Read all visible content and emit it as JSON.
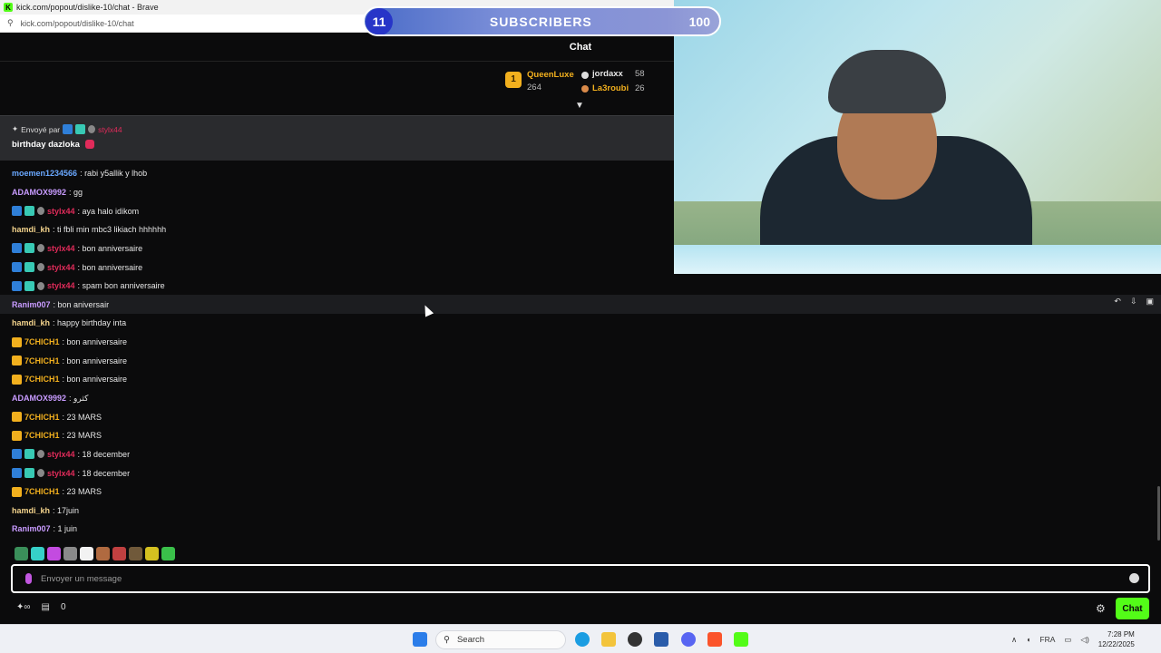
{
  "browser": {
    "title": "kick.com/popout/dislike-10/chat - Brave",
    "url": "kick.com/popout/dislike-10/chat"
  },
  "subgoal": {
    "current": "11",
    "label": "SUBSCRIBERS",
    "goal": "100"
  },
  "chat_title": "Chat",
  "leaderboard": {
    "first": {
      "name": "QueenLuxe",
      "count": "264"
    },
    "second": {
      "name": "jordaxx",
      "count": "58"
    },
    "third": {
      "name": "La3roubi",
      "count": "26"
    }
  },
  "pinned": {
    "sent_by_label": "Envoyé par",
    "sender": "stylx44",
    "message": "birthday dazloka"
  },
  "messages": [
    {
      "user": "moemen1234566",
      "color": "#6aa8ff",
      "badges": [],
      "text": ": rabi y5allik y lhob"
    },
    {
      "user": "ADAMOX9992",
      "color": "#c89bff",
      "badges": [],
      "text": ": gg"
    },
    {
      "user": "stylx44",
      "color": "#e02b5a",
      "badges": [
        "blue",
        "teal",
        "shield"
      ],
      "text": ": aya halo idikom"
    },
    {
      "user": "hamdi_kh",
      "color": "#f3d38c",
      "badges": [],
      "text": ": ti fbli min mbc3 likiach hhhhhh"
    },
    {
      "user": "stylx44",
      "color": "#e02b5a",
      "badges": [
        "blue",
        "teal",
        "shield"
      ],
      "text": ": bon anniversaire"
    },
    {
      "user": "stylx44",
      "color": "#e02b5a",
      "badges": [
        "blue",
        "teal",
        "shield"
      ],
      "text": ": bon anniversaire"
    },
    {
      "user": "stylx44",
      "color": "#e02b5a",
      "badges": [
        "blue",
        "teal",
        "shield"
      ],
      "text": ": spam bon anniversaire"
    },
    {
      "user": "Ranim007",
      "color": "#c89bff",
      "badges": [],
      "text": ": bon aniversair",
      "highlight": true
    },
    {
      "user": "hamdi_kh",
      "color": "#f3d38c",
      "badges": [],
      "text": ": happy birthday inta"
    },
    {
      "user": "7CHICH1",
      "color": "#f2b01e",
      "badges": [
        "crown"
      ],
      "text": ": bon anniversaire"
    },
    {
      "user": "7CHICH1",
      "color": "#f2b01e",
      "badges": [
        "crown"
      ],
      "text": ": bon anniversaire"
    },
    {
      "user": "7CHICH1",
      "color": "#f2b01e",
      "badges": [
        "crown"
      ],
      "text": ": bon anniversaire"
    },
    {
      "user": "ADAMOX9992",
      "color": "#c89bff",
      "badges": [],
      "text": ": كثرو"
    },
    {
      "user": "7CHICH1",
      "color": "#f2b01e",
      "badges": [
        "crown"
      ],
      "text": ": 23 MARS"
    },
    {
      "user": "7CHICH1",
      "color": "#f2b01e",
      "badges": [
        "crown"
      ],
      "text": ": 23 MARS"
    },
    {
      "user": "stylx44",
      "color": "#e02b5a",
      "badges": [
        "blue",
        "teal",
        "shield"
      ],
      "text": ": 18 december"
    },
    {
      "user": "stylx44",
      "color": "#e02b5a",
      "badges": [
        "blue",
        "teal",
        "shield"
      ],
      "text": ": 18 december"
    },
    {
      "user": "7CHICH1",
      "color": "#f2b01e",
      "badges": [
        "crown"
      ],
      "text": ": 23 MARS"
    },
    {
      "user": "hamdi_kh",
      "color": "#f3d38c",
      "badges": [],
      "text": ": 17juin"
    },
    {
      "user": "Ranim007",
      "color": "#c89bff",
      "badges": [],
      "text": ": 1 juin"
    }
  ],
  "input": {
    "placeholder": "Envoyer un message"
  },
  "bottom": {
    "gift_count": "0",
    "chat_button": "Chat"
  },
  "taskbar": {
    "search_placeholder": "Search",
    "lang": "FRA",
    "time": "7:28 PM",
    "date": "12/22/2025"
  },
  "emote_colors": [
    "#3a8f5a",
    "#36d0c8",
    "#c34be0",
    "#8a8a8a",
    "#f2f2f2",
    "#b06a40",
    "#c04040",
    "#70593a",
    "#d4c020",
    "#3ac04a"
  ],
  "colors": {
    "accent": "#53fc18",
    "background": "#0b0b0c",
    "pinned_bg": "#2a2b2e"
  }
}
